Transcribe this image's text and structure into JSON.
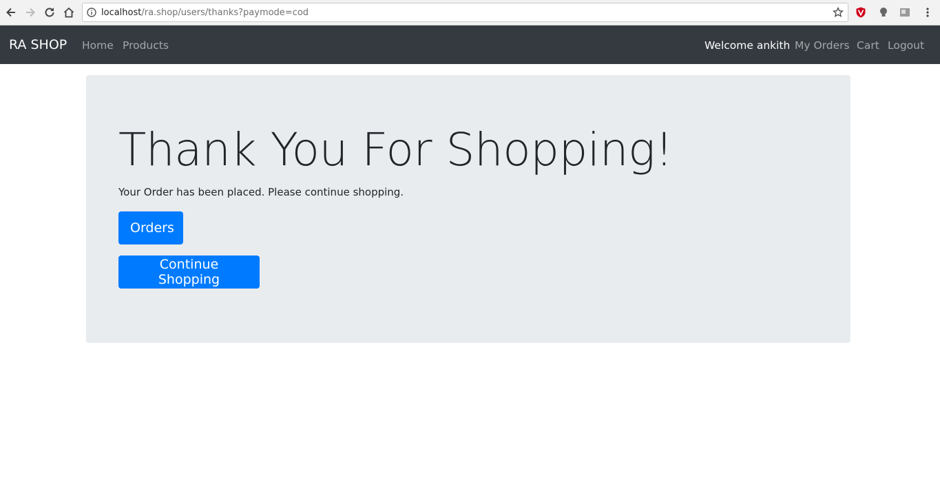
{
  "browser": {
    "url_host": "localhost",
    "url_path": "/ra.shop/users/thanks?paymode=cod"
  },
  "navbar": {
    "brand": "RA SHOP",
    "left_links": [
      "Home",
      "Products"
    ],
    "welcome": "Welcome ankith",
    "right_links": [
      "My Orders",
      "Cart",
      "Logout"
    ]
  },
  "jumbotron": {
    "heading": "Thank You For Shopping!",
    "message": "Your Order has been placed. Please continue shopping.",
    "orders_button": "Orders",
    "continue_button": "Continue Shopping"
  },
  "colors": {
    "navbar_bg": "#343a40",
    "jumbotron_bg": "#e9ecef",
    "primary": "#007bff"
  }
}
